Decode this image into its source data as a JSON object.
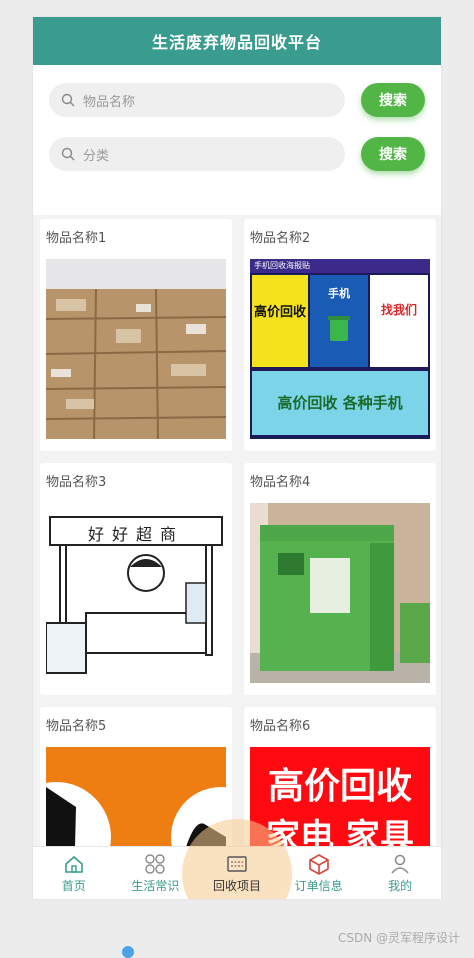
{
  "header": {
    "title": "生活废弃物品回收平台"
  },
  "search": [
    {
      "placeholder": "物品名称",
      "button": "搜索"
    },
    {
      "placeholder": "分类",
      "button": "搜索"
    }
  ],
  "items": [
    {
      "title": "物品名称1"
    },
    {
      "title": "物品名称2",
      "poster_text": [
        "手机回收海报贴",
        "高价回收",
        "手机",
        "找我们",
        "高价回收 各种手机"
      ]
    },
    {
      "title": "物品名称3",
      "sign_text": "好好超商"
    },
    {
      "title": "物品名称4"
    },
    {
      "title": "物品名称5"
    },
    {
      "title": "物品名称6",
      "banner_text": [
        "高价回收",
        "家电 家具"
      ]
    }
  ],
  "tabbar": [
    {
      "label": "首页",
      "icon": "home-icon"
    },
    {
      "label": "生活常识",
      "icon": "grid-icon"
    },
    {
      "label": "回收项目",
      "icon": "recycle-board-icon"
    },
    {
      "label": "订单信息",
      "icon": "box-icon"
    },
    {
      "label": "我的",
      "icon": "user-icon"
    }
  ],
  "watermark": "CSDN @灵军程序设计",
  "colors": {
    "primary": "#3a9b8f",
    "button": "#52b646"
  }
}
